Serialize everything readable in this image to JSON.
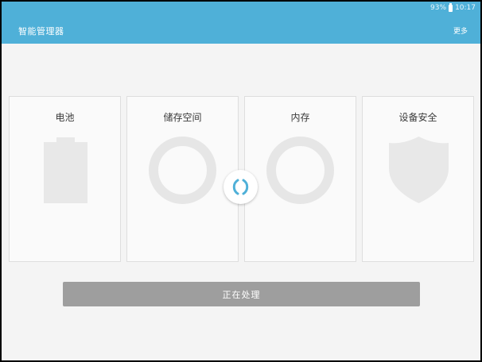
{
  "status_bar": {
    "battery": "93%",
    "time": "10:17"
  },
  "app_bar": {
    "title": "智能管理器",
    "more_label": "更多"
  },
  "cards": [
    {
      "label": "电池",
      "icon": "battery-icon"
    },
    {
      "label": "储存空间",
      "icon": "ring-icon"
    },
    {
      "label": "内存",
      "icon": "ring-icon"
    },
    {
      "label": "设备安全",
      "icon": "shield-icon"
    }
  ],
  "action_button": {
    "label": "正在处理"
  },
  "colors": {
    "accent": "#4fb0d8",
    "spinner": "#4fb0d8",
    "button": "#9e9e9e",
    "placeholder_icon": "#e6e6e6"
  }
}
